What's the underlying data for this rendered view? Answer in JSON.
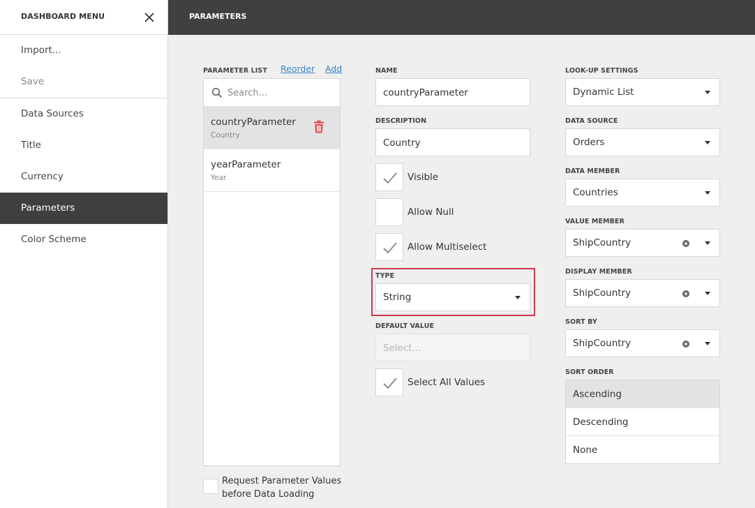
{
  "menu": {
    "title": "DASHBOARD MENU",
    "items": [
      {
        "label": "Import..."
      },
      {
        "label": "Save"
      },
      {
        "label": "Data Sources"
      },
      {
        "label": "Title"
      },
      {
        "label": "Currency"
      },
      {
        "label": "Parameters"
      },
      {
        "label": "Color Scheme"
      }
    ]
  },
  "header": {
    "title": "PARAMETERS"
  },
  "parameter_list": {
    "label": "PARAMETER LIST",
    "reorder_label": "Reorder",
    "add_label": "Add",
    "search_placeholder": "Search...",
    "items": [
      {
        "name": "countryParameter",
        "description": "Country"
      },
      {
        "name": "yearParameter",
        "description": "Year"
      }
    ]
  },
  "request_values_label": "Request Parameter Values before Data Loading",
  "form": {
    "name_label": "NAME",
    "name_value": "countryParameter",
    "description_label": "DESCRIPTION",
    "description_value": "Country",
    "visible_label": "Visible",
    "allow_null_label": "Allow Null",
    "allow_multiselect_label": "Allow Multiselect",
    "type_label": "TYPE",
    "type_value": "String",
    "default_value_label": "DEFAULT VALUE",
    "default_value_placeholder": "Select...",
    "select_all_label": "Select All Values"
  },
  "lookup": {
    "lookup_label": "LOOK-UP SETTINGS",
    "lookup_value": "Dynamic List",
    "data_source_label": "DATA SOURCE",
    "data_source_value": "Orders",
    "data_member_label": "DATA MEMBER",
    "data_member_value": "Countries",
    "value_member_label": "VALUE MEMBER",
    "value_member_value": "ShipCountry",
    "display_member_label": "DISPLAY MEMBER",
    "display_member_value": "ShipCountry",
    "sort_by_label": "SORT BY",
    "sort_by_value": "ShipCountry",
    "sort_order_label": "SORT ORDER",
    "sort_order_options": [
      "Ascending",
      "Descending",
      "None"
    ]
  },
  "colors": {
    "accent_dark": "#404040",
    "highlight_border": "#c8394f",
    "delete_icon": "#e05252",
    "link": "#3a82c4"
  }
}
